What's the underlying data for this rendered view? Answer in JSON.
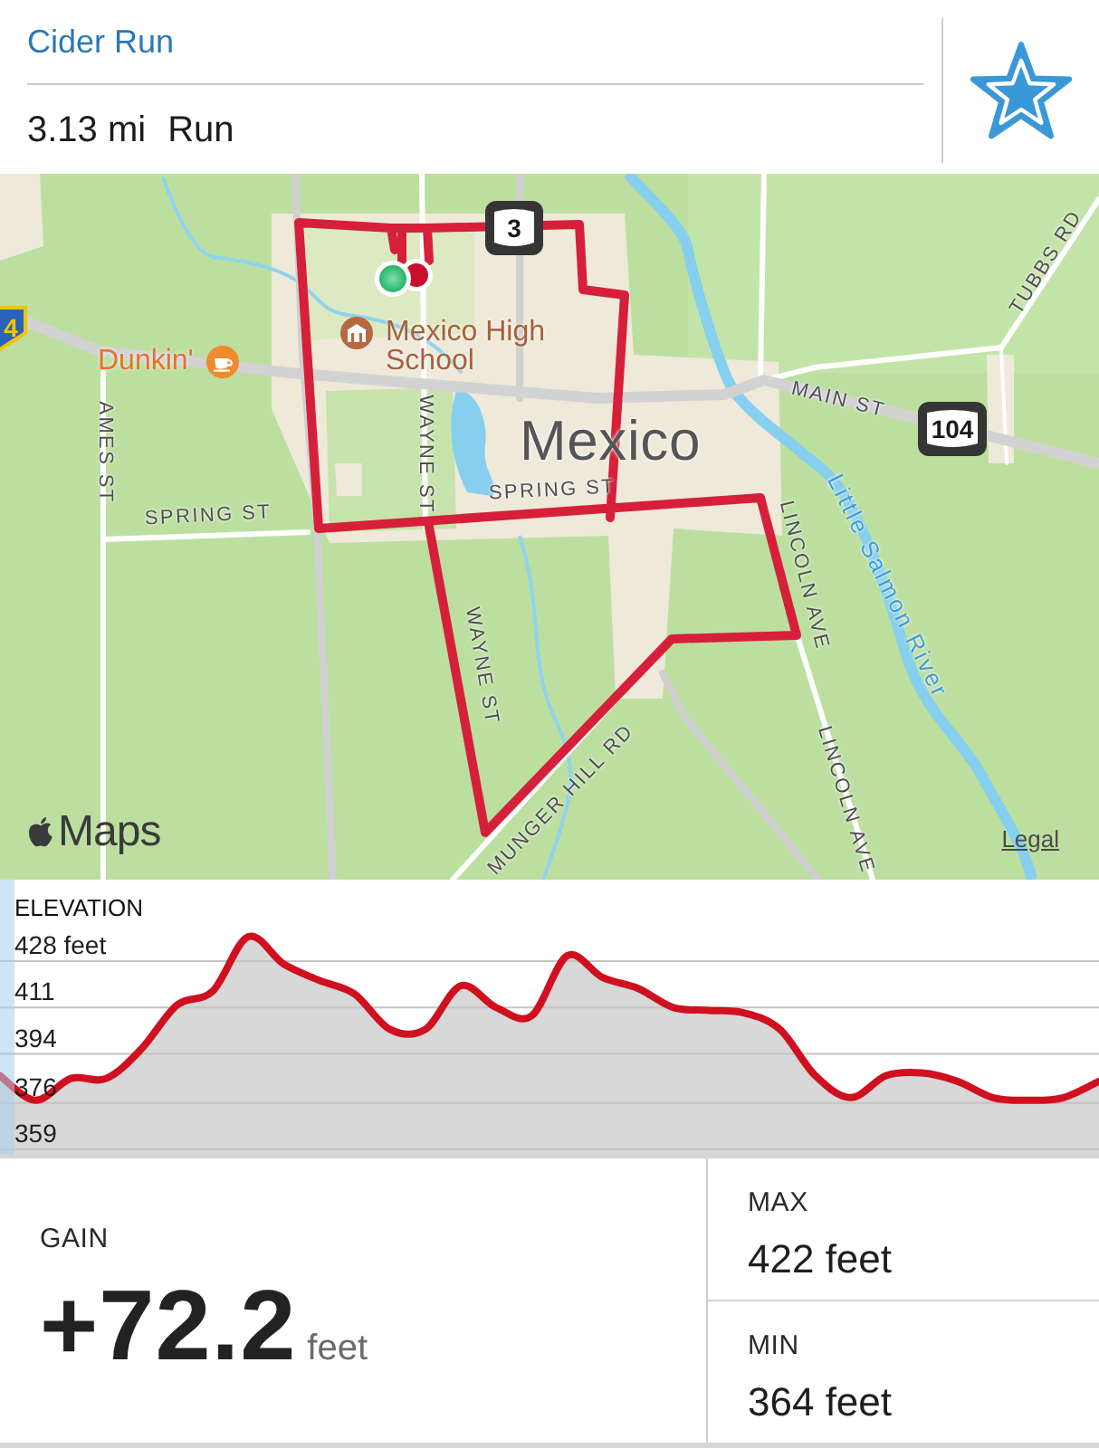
{
  "header": {
    "title": "Cider Run",
    "distance": "3.13 mi",
    "activity": "Run",
    "favorite": true
  },
  "map": {
    "labels": [
      {
        "kind": "street",
        "text": "TUBBS RD"
      },
      {
        "kind": "street",
        "text": "MAIN ST"
      },
      {
        "kind": "town",
        "text": "Mexico"
      },
      {
        "kind": "street",
        "text": "AMES ST"
      },
      {
        "kind": "street",
        "text": "WAYNE ST"
      },
      {
        "kind": "river",
        "text": "Little Salmon River"
      },
      {
        "kind": "street",
        "text": "SPRING ST"
      },
      {
        "kind": "street",
        "text": "SPRING ST"
      },
      {
        "kind": "street",
        "text": "LINCOLN AVE"
      },
      {
        "kind": "street",
        "text": "WAYNE ST"
      },
      {
        "kind": "street",
        "text": "MUNGER HILL RD"
      },
      {
        "kind": "street",
        "text": "LINCOLN AVE"
      }
    ],
    "places": [
      {
        "kind": "cafe",
        "text": "Dunkin'"
      },
      {
        "kind": "school",
        "text": "Mexico High School"
      }
    ],
    "shields": [
      {
        "kind": "state",
        "text": "3"
      },
      {
        "kind": "county",
        "text": "4"
      },
      {
        "kind": "state",
        "text": "104"
      }
    ],
    "attribution": "Maps",
    "legal_link": "Legal"
  },
  "elevation": {
    "chart_data": {
      "type": "area",
      "title": "ELEVATION",
      "series": [
        {
          "color": "#d0101e",
          "values": [
            386,
            377,
            385,
            385,
            396,
            412,
            417,
            437,
            427,
            421,
            416,
            403,
            403,
            419,
            411,
            408,
            430,
            422,
            418,
            411,
            410,
            409,
            403,
            386,
            378,
            386,
            387,
            384,
            378,
            377,
            378,
            384
          ]
        }
      ],
      "ylim": [
        355.7,
        457.9
      ],
      "yticks": [
        359,
        376,
        394,
        411,
        {
          "value": 428,
          "label": "428 feet"
        }
      ],
      "grid": true
    }
  },
  "stats": {
    "gain": {
      "label": "GAIN",
      "value": "+72.2",
      "unit": "feet"
    },
    "max": {
      "label": "MAX",
      "value": "422 feet"
    },
    "min": {
      "label": "MIN",
      "value": "364 feet"
    }
  }
}
